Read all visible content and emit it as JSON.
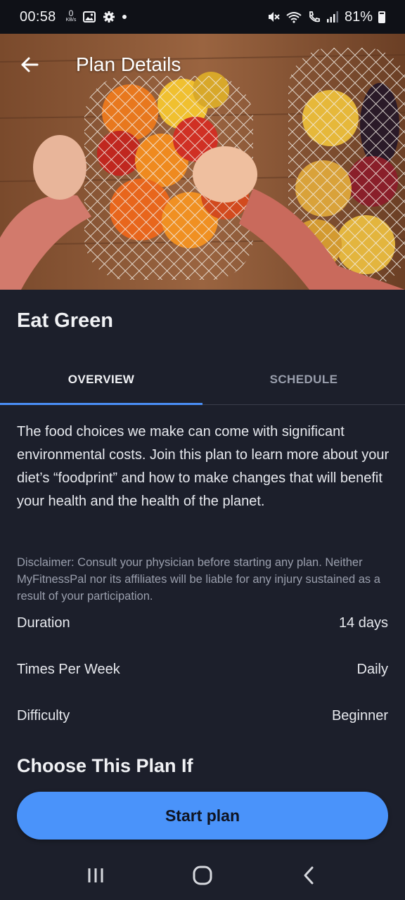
{
  "status_bar": {
    "time": "00:58",
    "net_speed_value": "0",
    "net_speed_unit": "KB/s",
    "battery": "81%",
    "battery_level": 0.81,
    "icons": [
      "gallery-icon",
      "settings-icon",
      "mute-icon",
      "wifi-icon",
      "wifi-calling-icon",
      "signal-icon"
    ]
  },
  "header": {
    "title": "Plan Details",
    "back_icon": "arrow-left-icon"
  },
  "plan": {
    "name": "Eat Green"
  },
  "tabs": [
    {
      "label": "OVERVIEW",
      "active": true
    },
    {
      "label": "SCHEDULE",
      "active": false
    }
  ],
  "overview": {
    "description": "The food choices we make can come with significant environmental costs. Join this plan to learn more about your diet’s “foodprint” and how to make changes that will benefit your health and the health of the planet.",
    "disclaimer": "Disclaimer: Consult your physician before starting any plan. Neither MyFitnessPal nor its affiliates will be liable for any injury sustained as a result of your participation."
  },
  "details": [
    {
      "label": "Duration",
      "value": "14 days"
    },
    {
      "label": "Times Per Week",
      "value": "Daily"
    },
    {
      "label": "Difficulty",
      "value": "Beginner"
    }
  ],
  "section": {
    "choose_heading": "Choose This Plan If"
  },
  "cta": {
    "start_label": "Start plan"
  },
  "colors": {
    "background": "#1c1f2b",
    "accent": "#4a93fa",
    "tab_indicator": "#4a8ff7"
  },
  "nav": {
    "icons": [
      "recent-apps-icon",
      "home-icon",
      "back-icon"
    ]
  }
}
